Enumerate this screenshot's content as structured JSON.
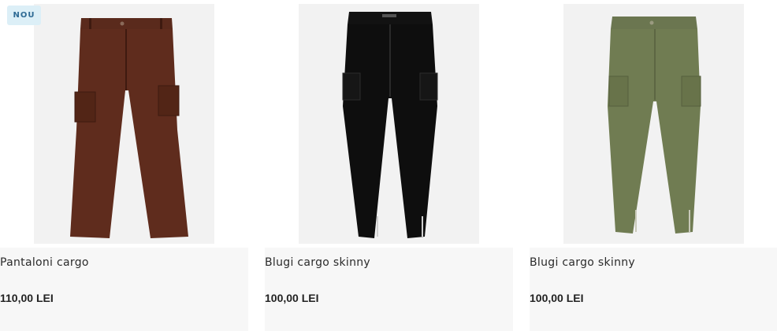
{
  "products": [
    {
      "badge": "NOU",
      "title": "Pantaloni cargo",
      "price": "110,00 LEI",
      "color": "#5a2a1c",
      "image": "brown-wide-cargo-pants"
    },
    {
      "title": "Blugi cargo skinny",
      "price": "100,00 LEI",
      "color": "#111111",
      "image": "black-skinny-cargo-jeans"
    },
    {
      "title": "Blugi cargo skinny",
      "price": "100,00 LEI",
      "color": "#6e7a4e",
      "image": "khaki-skinny-cargo-jeans"
    }
  ]
}
